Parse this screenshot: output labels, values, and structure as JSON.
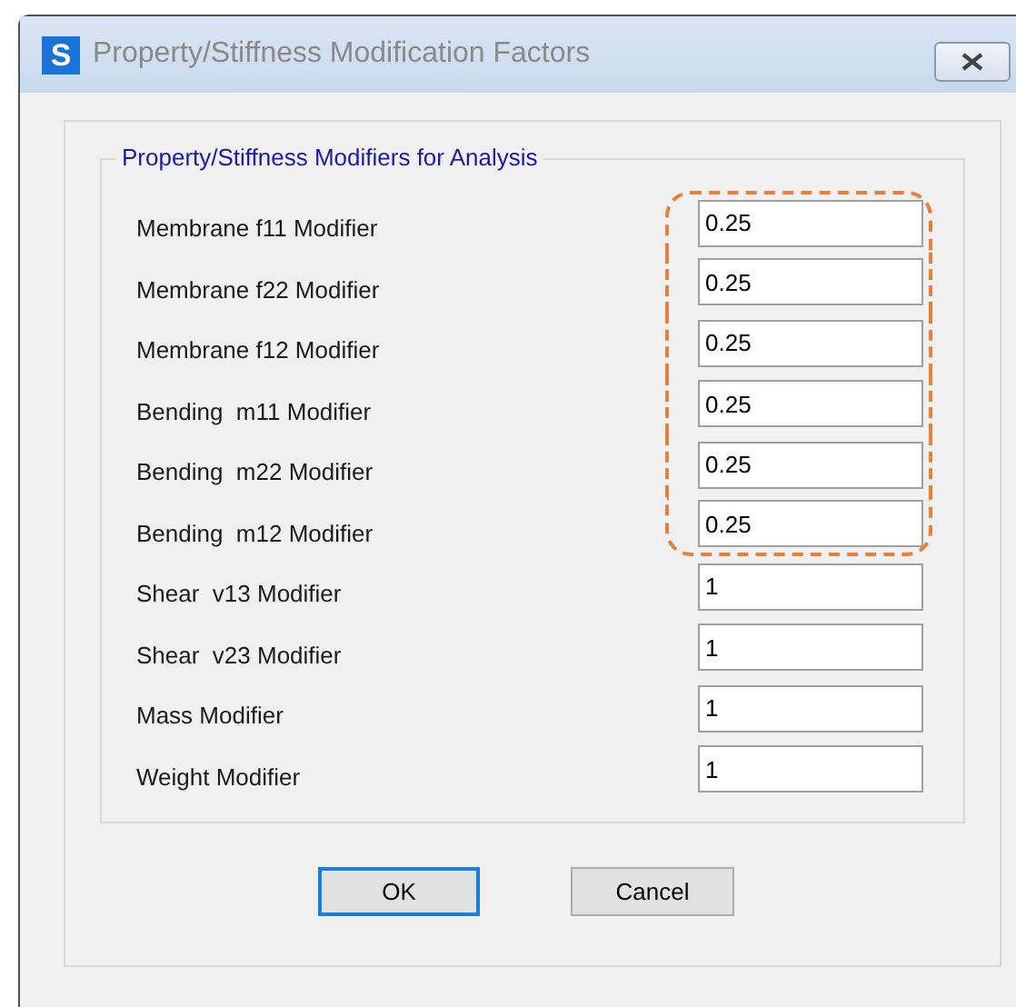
{
  "window": {
    "title": "Property/Stiffness Modification Factors",
    "app_letter": "S"
  },
  "group": {
    "title": "Property/Stiffness Modifiers for Analysis"
  },
  "modifiers": [
    {
      "label": "Membrane f11 Modifier",
      "value": "0.25",
      "highlighted": true
    },
    {
      "label": "Membrane f22 Modifier",
      "value": "0.25",
      "highlighted": true
    },
    {
      "label": "Membrane f12 Modifier",
      "value": "0.25",
      "highlighted": true
    },
    {
      "label": "Bending  m11 Modifier",
      "value": "0.25",
      "highlighted": true
    },
    {
      "label": "Bending  m22 Modifier",
      "value": "0.25",
      "highlighted": true
    },
    {
      "label": "Bending  m12 Modifier",
      "value": "0.25",
      "highlighted": true
    },
    {
      "label": "Shear  v13 Modifier",
      "value": "1",
      "highlighted": false
    },
    {
      "label": "Shear  v23 Modifier",
      "value": "1",
      "highlighted": false
    },
    {
      "label": "Mass Modifier",
      "value": "1",
      "highlighted": false
    },
    {
      "label": "Weight Modifier",
      "value": "1",
      "highlighted": false
    }
  ],
  "buttons": [
    {
      "label": "OK",
      "default": true
    },
    {
      "label": "Cancel",
      "default": false
    }
  ]
}
